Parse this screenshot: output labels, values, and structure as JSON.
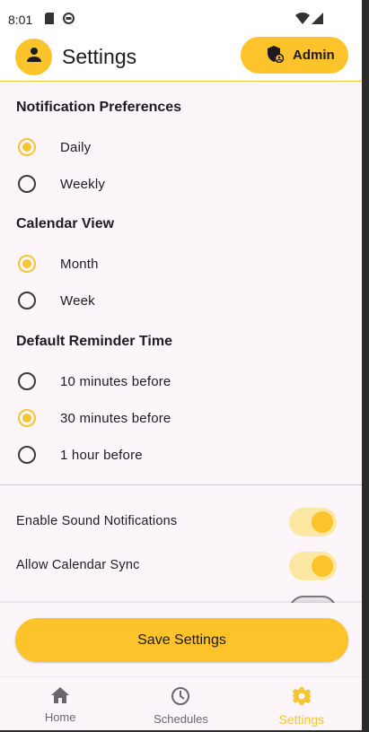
{
  "status_bar": {
    "time": "8:01"
  },
  "app_bar": {
    "title": "Settings",
    "admin_label": "Admin"
  },
  "sections": {
    "notifications": {
      "title": "Notification Preferences",
      "options": [
        {
          "label": "Daily",
          "selected": true
        },
        {
          "label": "Weekly",
          "selected": false
        }
      ]
    },
    "calendar": {
      "title": "Calendar View",
      "options": [
        {
          "label": "Month",
          "selected": true
        },
        {
          "label": "Week",
          "selected": false
        }
      ]
    },
    "reminder": {
      "title": "Default Reminder Time",
      "options": [
        {
          "label": "10 minutes before",
          "selected": false
        },
        {
          "label": "30 minutes before",
          "selected": true
        },
        {
          "label": "1 hour before",
          "selected": false
        }
      ]
    }
  },
  "toggles": [
    {
      "label": "Enable Sound Notifications",
      "on": true
    },
    {
      "label": "Allow Calendar Sync",
      "on": true
    }
  ],
  "save_button": {
    "label": "Save Settings"
  },
  "bottom_nav": {
    "items": [
      {
        "label": "Home",
        "icon": "home-icon",
        "active": false
      },
      {
        "label": "Schedules",
        "icon": "clock-icon",
        "active": false
      },
      {
        "label": "Settings",
        "icon": "gear-icon",
        "active": true
      }
    ]
  },
  "colors": {
    "accent": "#fcc32b",
    "background": "#fcf6fb",
    "text": "#1d1b20"
  }
}
